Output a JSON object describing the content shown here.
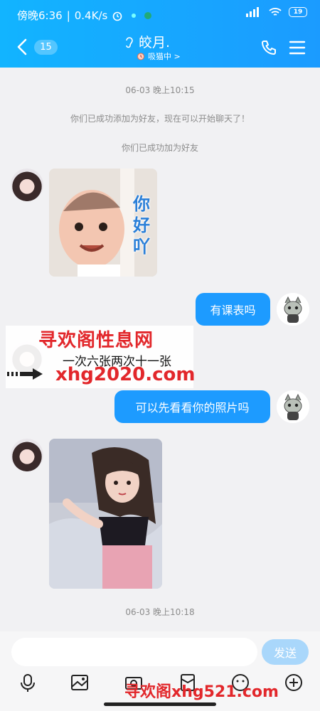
{
  "status_bar": {
    "time": "傍晚6:36",
    "speed": "0.4K/s",
    "battery": "19"
  },
  "header": {
    "unread_count": "15",
    "contact_name": "皎月.",
    "contact_status": "吸猫中 >"
  },
  "messages": {
    "time_1": "06-03 晚上10:15",
    "system_1": "你们已成功添加为好友，现在可以开始聊天了！",
    "system_2": "你们已成功加为好友",
    "sticker_text": "你好吖",
    "out_1": "有课表吗",
    "out_2": "可以先看看你的照片吗",
    "time_2": "06-03 晚上10:18"
  },
  "watermark": {
    "line1": "寻欢阁性息网",
    "line2": "一次六张两次十一张",
    "line3": "xhg2020.com",
    "footer": "寻欢阁xhg521.com"
  },
  "composer": {
    "send_label": "发送"
  }
}
